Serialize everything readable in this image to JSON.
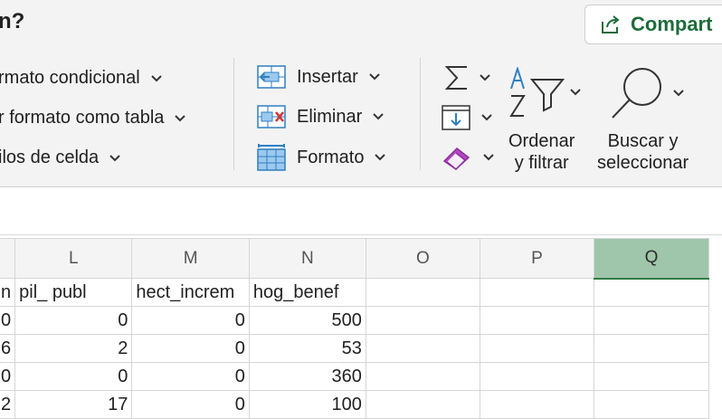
{
  "header": {
    "title_fragment": "n?",
    "share_label": "Compart"
  },
  "styles_group": {
    "conditional_format": "rmato condicional",
    "format_as_table": "r formato como tabla",
    "cell_styles": "ilos de celda"
  },
  "cells_group": {
    "insert": "Insertar",
    "delete": "Eliminar",
    "format": "Formato"
  },
  "editing_group": {
    "sort_filter_line1": "Ordenar",
    "sort_filter_line2": "y filtrar",
    "find_select_line1": "Buscar y",
    "find_select_line2": "seleccionar"
  },
  "icons": {
    "share": "share-icon",
    "autosum": "sigma-icon",
    "fill": "fill-down-icon",
    "clear": "eraser-icon",
    "sort_filter": "sort-filter-icon",
    "find": "magnifier-icon",
    "insert": "insert-cells-icon",
    "delete": "delete-cells-icon",
    "format": "format-cells-icon"
  },
  "colors": {
    "accent_green": "#1e6b3a",
    "selected_column": "#9fc6aa",
    "eraser_purple": "#b146c2",
    "icon_blue": "#2f7fc1",
    "delete_red": "#d13438"
  },
  "grid": {
    "columns": [
      "",
      "L",
      "M",
      "N",
      "O",
      "P",
      "Q"
    ],
    "selected_column": "Q",
    "rows": [
      [
        "n",
        "pil_ publ",
        "hect_increm",
        "hog_benef",
        "",
        "",
        ""
      ],
      [
        "0",
        "0",
        "0",
        "500",
        "",
        "",
        ""
      ],
      [
        "6",
        "2",
        "0",
        "53",
        "",
        "",
        ""
      ],
      [
        "0",
        "0",
        "0",
        "360",
        "",
        "",
        ""
      ],
      [
        "2",
        "17",
        "0",
        "100",
        "",
        "",
        ""
      ]
    ]
  }
}
